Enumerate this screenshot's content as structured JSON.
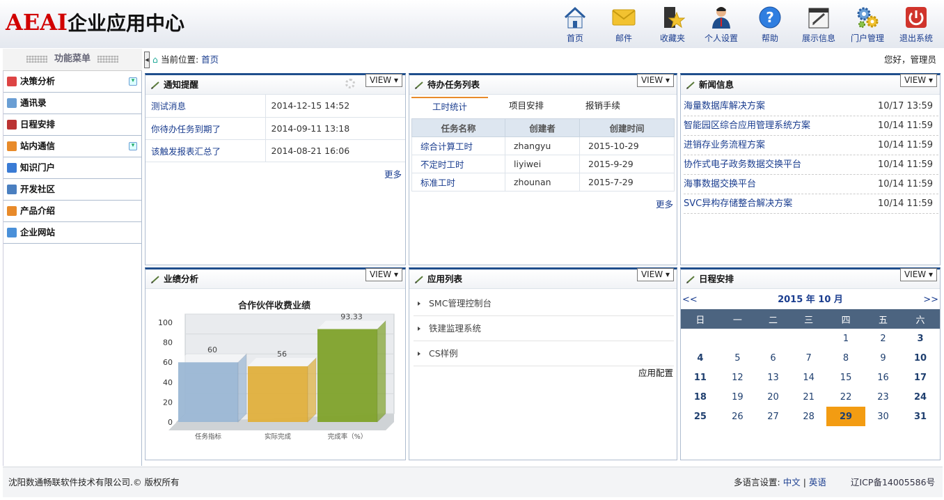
{
  "header": {
    "brand": "AEAI",
    "title": "企业应用中心"
  },
  "topnav": [
    {
      "label": "首页",
      "icon": "home-icon"
    },
    {
      "label": "邮件",
      "icon": "mail-icon"
    },
    {
      "label": "收藏夹",
      "icon": "favorites-icon"
    },
    {
      "label": "个人设置",
      "icon": "user-settings-icon"
    },
    {
      "label": "帮助",
      "icon": "help-icon"
    },
    {
      "label": "展示信息",
      "icon": "notebook-icon"
    },
    {
      "label": "门户管理",
      "icon": "gears-icon"
    },
    {
      "label": "退出系统",
      "icon": "power-icon"
    }
  ],
  "sidebar": {
    "title": "功能菜单",
    "items": [
      {
        "label": "决策分析",
        "icon": "bar-chart-icon",
        "color": "#d44"
      },
      {
        "label": "通讯录",
        "icon": "address-book-icon",
        "color": "#6a9ed4"
      },
      {
        "label": "日程安排",
        "icon": "calendar-icon",
        "color": "#b33"
      },
      {
        "label": "站内通信",
        "icon": "message-icon",
        "color": "#e88a2a"
      },
      {
        "label": "知识门户",
        "icon": "knowledge-icon",
        "color": "#3a7bd5"
      },
      {
        "label": "开发社区",
        "icon": "community-icon",
        "color": "#4a7fc0"
      },
      {
        "label": "产品介绍",
        "icon": "product-icon",
        "color": "#e88a2a"
      },
      {
        "label": "企业网站",
        "icon": "website-icon",
        "color": "#4a90d9"
      }
    ]
  },
  "breadcrumb": {
    "prefix": "当前位置:",
    "current": "首页"
  },
  "greeting": "您好，管理员",
  "view_label": "VIEW",
  "notices": {
    "title": "通知提醒",
    "rows": [
      {
        "text": "测试消息",
        "time": "2014-12-15 14:52"
      },
      {
        "text": "你待办任务到期了",
        "time": "2014-09-11 13:18"
      },
      {
        "text": "该触发报表汇总了",
        "time": "2014-08-21 16:06"
      }
    ],
    "more": "更多"
  },
  "tasks": {
    "title": "待办任务列表",
    "tabs": [
      "工时统计",
      "项目安排",
      "报销手续"
    ],
    "columns": [
      "任务名称",
      "创建者",
      "创建时间"
    ],
    "rows": [
      [
        "综合计算工时",
        "zhangyu",
        "2015-10-29"
      ],
      [
        "不定时工时",
        "liyiwei",
        "2015-9-29"
      ],
      [
        "标准工时",
        "zhounan",
        "2015-7-29"
      ]
    ],
    "more": "更多"
  },
  "news": {
    "title": "新闻信息",
    "rows": [
      {
        "text": "海量数据库解决方案",
        "time": "10/17 13:59"
      },
      {
        "text": "智能园区综合应用管理系统方案",
        "time": "10/14 11:59"
      },
      {
        "text": "进销存业务流程方案",
        "time": "10/14 11:59"
      },
      {
        "text": "协作式电子政务数据交换平台",
        "time": "10/14 11:59"
      },
      {
        "text": "海事数据交换平台",
        "time": "10/14 11:59"
      },
      {
        "text": "SVC异构存储整合解决方案",
        "time": "10/14 11:59"
      }
    ]
  },
  "performance": {
    "title": "业绩分析"
  },
  "chart_data": {
    "type": "bar",
    "title": "合作伙伴收费业绩",
    "categories": [
      "任务指标",
      "实际完成",
      "完成率（%）"
    ],
    "values": [
      60,
      56,
      93.33
    ],
    "colors": [
      "#9bb7d4",
      "#e0b03c",
      "#7fa22a"
    ],
    "ylim": [
      0,
      100
    ],
    "yticks": [
      0,
      20,
      40,
      60,
      80,
      100
    ]
  },
  "apps": {
    "title": "应用列表",
    "items": [
      "SMC管理控制台",
      "铁建监理系统",
      "CS样例"
    ],
    "config": "应用配置"
  },
  "schedule": {
    "title": "日程安排",
    "prev": "<<",
    "next": ">>",
    "month_label": "2015 年 10 月",
    "weekdays": [
      "日",
      "一",
      "二",
      "三",
      "四",
      "五",
      "六"
    ],
    "first_weekday": 4,
    "days": 31,
    "today": 29
  },
  "footer": {
    "copyright": "沈阳数通畅联软件技术有限公司.© 版权所有",
    "lang_label": "多语言设置:",
    "lang_options": [
      "中文",
      "英语"
    ],
    "icp": "辽ICP备14005586号"
  }
}
